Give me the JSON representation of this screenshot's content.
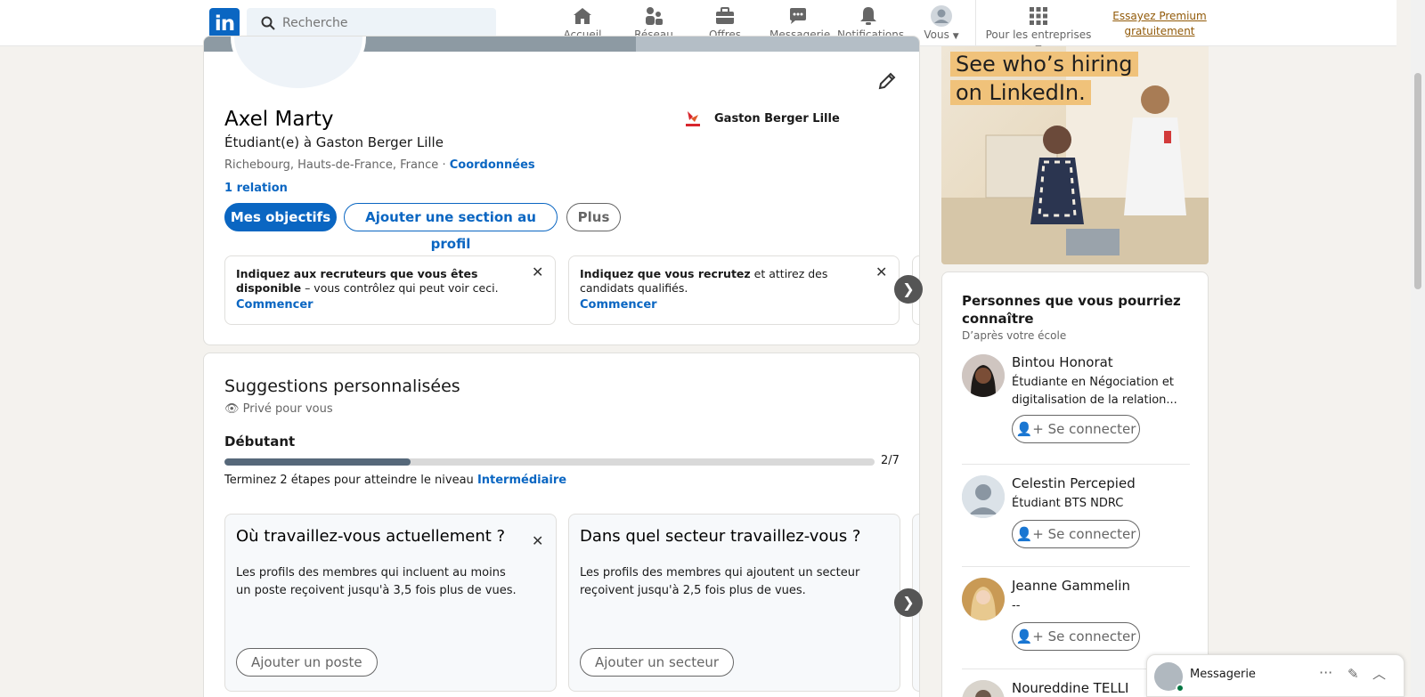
{
  "header": {
    "logo_text": "in",
    "search_placeholder": "Recherche",
    "nav": [
      {
        "label": "Accueil",
        "icon": "home-icon"
      },
      {
        "label": "Réseau",
        "icon": "network-icon"
      },
      {
        "label": "Offres d'emploi",
        "icon": "briefcase-icon"
      },
      {
        "label": "Messagerie",
        "icon": "chat-icon"
      },
      {
        "label": "Notifications",
        "icon": "bell-icon"
      },
      {
        "label": "Vous",
        "icon": "avatar-icon"
      }
    ],
    "business_label": "Pour les entreprises",
    "premium_label": "Essayez Premium gratuitement"
  },
  "profile": {
    "name": "Axel Marty",
    "headline": "Étudiant(e) à Gaston Berger Lille",
    "location": "Richebourg, Hauts-de-France, France · ",
    "contact_link": "Coordonnées",
    "relations": "1 relation",
    "school": "Gaston Berger Lille",
    "buttons": {
      "goals": "Mes objectifs",
      "add_section": "Ajouter une section au profil",
      "more": "Plus"
    },
    "info_boxes": [
      {
        "bold": "Indiquez aux recruteurs que vous êtes disponible",
        "text": " – vous contrôlez qui peut voir ceci.",
        "cta": "Commencer"
      },
      {
        "bold": "Indiquez que vous recrutez",
        "text": " et attirez des candidats qualifiés.",
        "cta": "Commencer"
      }
    ]
  },
  "suggestions": {
    "title": "Suggestions personnalisées",
    "private": "Privé pour vous",
    "level": "Débutant",
    "progress_fraction": 0.2857,
    "progress_label": "2/7",
    "hint_prefix": "Terminez 2 étapes pour atteindre le niveau ",
    "hint_level": "Intermédiaire",
    "tasks": [
      {
        "title": "Où travaillez-vous actuellement ?",
        "text": "Les profils des membres qui incluent au moins un poste reçoivent jusqu'à 3,5 fois plus de vues.",
        "button": "Ajouter un poste"
      },
      {
        "title": "Dans quel secteur travaillez-vous ?",
        "text": "Les profils des membres qui ajoutent un secteur reçoivent jusqu'à 2,5 fois plus de vues.",
        "button": "Ajouter un secteur"
      }
    ]
  },
  "ad": {
    "line1": "See who’s hiring",
    "line2": "on LinkedIn."
  },
  "pymk": {
    "title": "Personnes que vous pourriez connaître",
    "subtitle": "D’après votre école",
    "connect_label": "Se connecter",
    "people": [
      {
        "name": "Bintou Honorat",
        "desc": "Étudiante en Négociation et digitalisation de la relation..."
      },
      {
        "name": "Celestin Percepied",
        "desc": "Étudiant BTS NDRC"
      },
      {
        "name": "Jeanne Gammelin",
        "desc": "--"
      },
      {
        "name": "Noureddine TELLI",
        "desc": ""
      }
    ]
  },
  "messaging": {
    "label": "Messagerie"
  },
  "colors": {
    "brand": "#0a66c2",
    "premium": "#915907",
    "progress": "#56687a"
  }
}
